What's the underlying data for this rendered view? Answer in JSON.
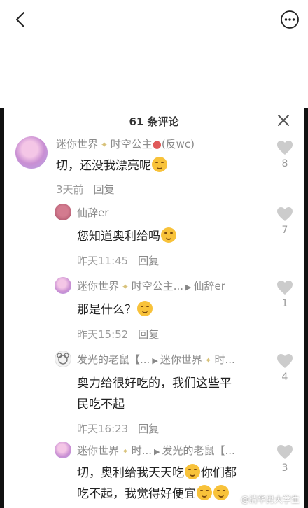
{
  "sheet": {
    "title": "61 条评论"
  },
  "comments": [
    {
      "name_parts": [
        "迷你世界",
        "时空公主",
        "(反wc)"
      ],
      "text": "切，还没我漂亮呢",
      "time": "3天前",
      "reply": "回复",
      "likes": "8"
    },
    {
      "name_parts": [
        "仙辞er"
      ],
      "text": "您知道奥利给吗",
      "time": "昨天11:45",
      "reply": "回复",
      "likes": "7"
    },
    {
      "name_parts": [
        "迷你世界",
        "时空公主...",
        "仙辞er"
      ],
      "text": "那是什么？",
      "time": "昨天15:52",
      "reply": "回复",
      "likes": "1"
    },
    {
      "name_parts": [
        "发光的老鼠【...",
        "迷你世界",
        "时..."
      ],
      "text_lines": [
        "奥力给很好吃的，我们这些平",
        "民吃不起"
      ],
      "time": "昨天16:23",
      "reply": "回复",
      "likes": "4"
    },
    {
      "name_parts": [
        "迷你世界",
        "时...",
        "发光的老鼠【..."
      ],
      "text_lines": [
        "切，奥利给我天天吃",
        "你们都",
        "吃不起，我觉得好便宜"
      ],
      "likes": "3"
    }
  ],
  "watermark": "@清华男大学生",
  "colors": {
    "text": "#222222",
    "muted": "#9a9a9a",
    "like_icon": "#cccccc",
    "emoji": "#f8c23a"
  },
  "icons": [
    "back-icon",
    "more-icon",
    "close-icon",
    "heart-icon",
    "smile-emoji",
    "sparkle-icon",
    "reply-arrow-icon"
  ]
}
